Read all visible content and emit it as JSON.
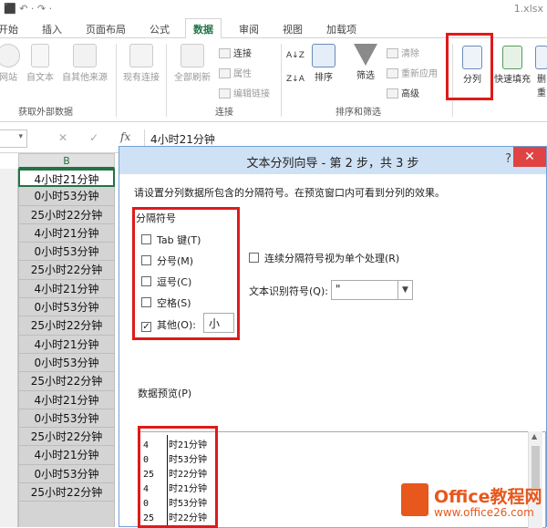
{
  "app": {
    "filename": "1.xlsx"
  },
  "tabs": [
    {
      "label": "开始"
    },
    {
      "label": "插入"
    },
    {
      "label": "页面布局"
    },
    {
      "label": "公式"
    },
    {
      "label": "数据"
    },
    {
      "label": "审阅"
    },
    {
      "label": "视图"
    },
    {
      "label": "加载项"
    }
  ],
  "ribbon": {
    "external": {
      "group_label": "获取外部数据",
      "buttons": [
        {
          "label": "网站"
        },
        {
          "label": "自文本"
        },
        {
          "label": "自其他来源"
        },
        {
          "label": "现有连接"
        }
      ]
    },
    "connections": {
      "group_label": "连接",
      "refresh_all": "全部刷新",
      "small": [
        {
          "label": "连接"
        },
        {
          "label": "属性"
        },
        {
          "label": "编辑链接"
        }
      ]
    },
    "sort_filter": {
      "group_label": "排序和筛选",
      "sort_az": "A↓Z",
      "sort_za": "Z↓A",
      "sort": "排序",
      "filter": "筛选",
      "small": [
        {
          "label": "清除"
        },
        {
          "label": "重新应用"
        },
        {
          "label": "高级"
        }
      ]
    },
    "data_tools": {
      "split": "分列",
      "flash_fill": "快速填充",
      "remove_dup_1": "删",
      "remove_dup_2": "重"
    }
  },
  "formula_bar": {
    "cancel": "✕",
    "confirm": "✓",
    "fx": "fx",
    "value": "4小时21分钟"
  },
  "sheet": {
    "column": "B",
    "cells": [
      "4小时21分钟",
      "0小时53分钟",
      "25小时22分钟",
      "4小时21分钟",
      "0小时53分钟",
      "25小时22分钟",
      "4小时21分钟",
      "0小时53分钟",
      "25小时22分钟",
      "4小时21分钟",
      "0小时53分钟",
      "25小时22分钟",
      "4小时21分钟",
      "0小时53分钟",
      "25小时22分钟",
      "4小时21分钟",
      "0小时53分钟",
      "25小时22分钟"
    ]
  },
  "dialog": {
    "title": "文本分列向导 - 第 2 步，共 3 步",
    "help": "?",
    "close": "✕",
    "instruction": "请设置分列数据所包含的分隔符号。在预览窗口内可看到分列的效果。",
    "delimiters_title": "分隔符号",
    "options": [
      {
        "label": "Tab 键(T)",
        "checked": false
      },
      {
        "label": "分号(M)",
        "checked": false
      },
      {
        "label": "逗号(C)",
        "checked": false
      },
      {
        "label": "空格(S)",
        "checked": false
      },
      {
        "label": "其他(O):",
        "checked": true
      }
    ],
    "other_value": "小",
    "consecutive_label": "连续分隔符号视为单个处理(R)",
    "qualifier_label": "文本识别符号(Q):",
    "qualifier_value": "\"",
    "preview_label": "数据预览(P)",
    "preview_rows": [
      {
        "c1": "4",
        "c2": "时21分钟"
      },
      {
        "c1": "0",
        "c2": "时53分钟"
      },
      {
        "c1": "25",
        "c2": "时22分钟"
      },
      {
        "c1": "4",
        "c2": "时21分钟"
      },
      {
        "c1": "0",
        "c2": "时53分钟"
      },
      {
        "c1": "25",
        "c2": "时22分钟"
      }
    ]
  },
  "watermark": {
    "text": "Office教程网",
    "url": "www.office26.com"
  }
}
